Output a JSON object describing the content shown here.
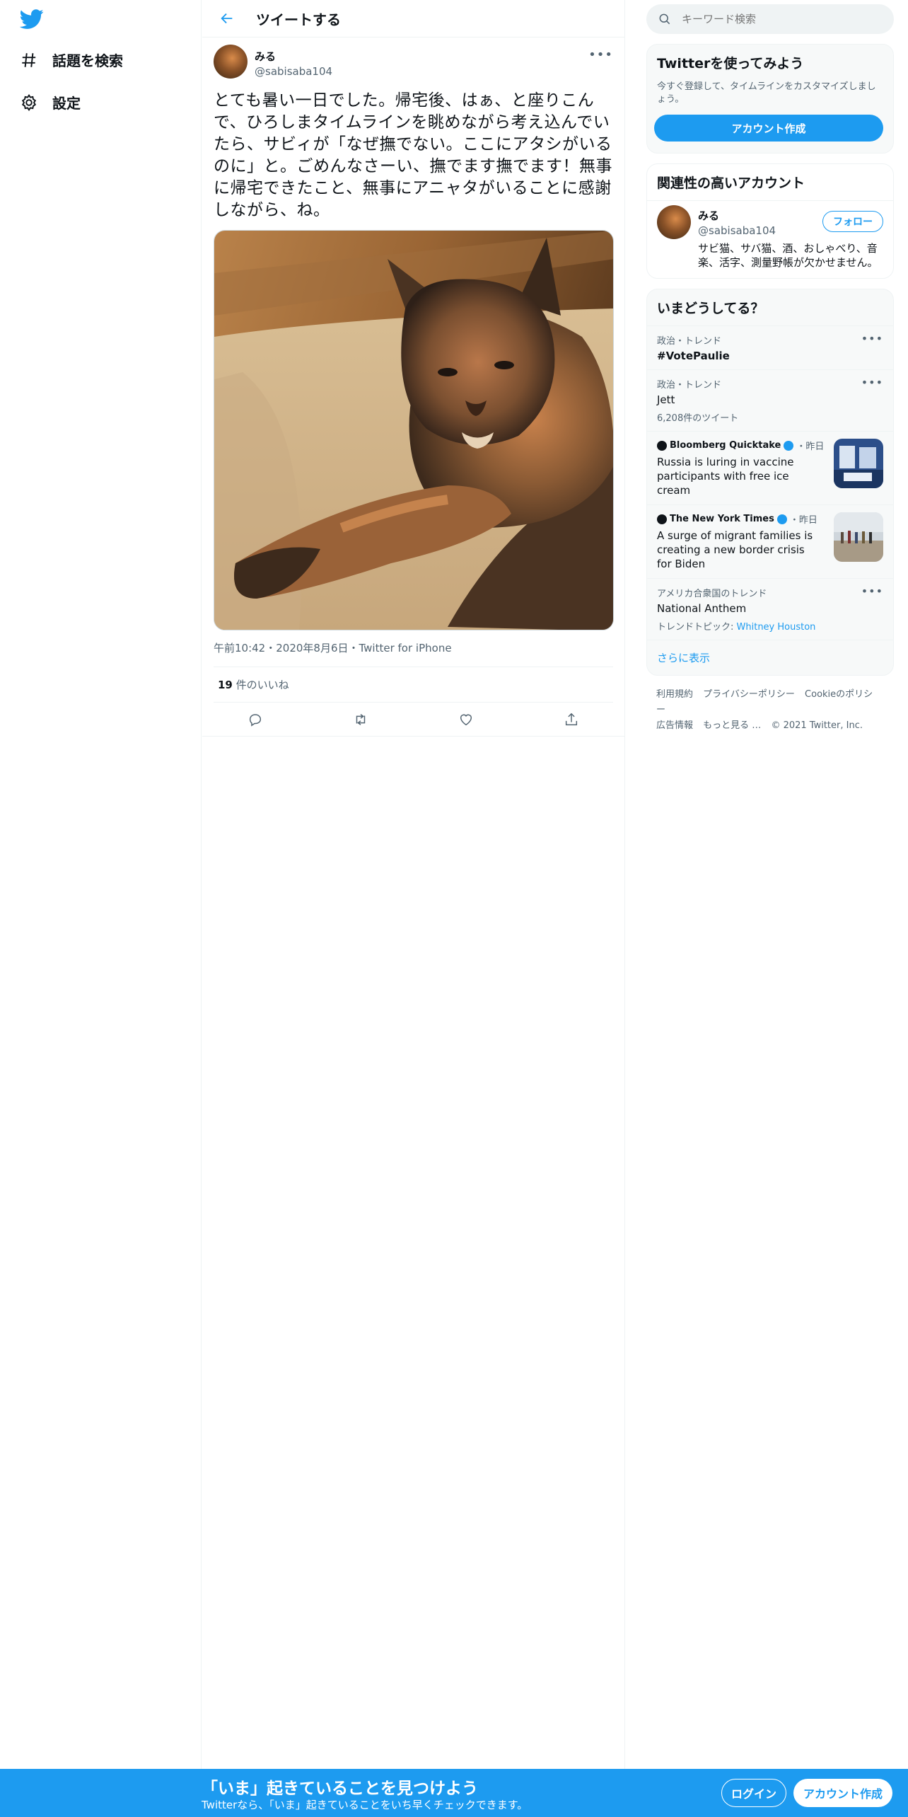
{
  "nav": {
    "explore_label": "話題を検索",
    "settings_label": "設定"
  },
  "header": {
    "title": "ツイートする"
  },
  "tweet": {
    "author_name": "みる",
    "author_handle": "@sabisaba104",
    "text": "とても暑い一日でした。帰宅後、はぁ、と座りこんで、ひろしまタイムラインを眺めながら考え込んでいたら、サビィが「なぜ撫でない。ここにアタシがいるのに」と。ごめんなさーい、撫でます撫でます！無事に帰宅できたこと、無事にアニャタがいることに感謝しながら、ね。",
    "meta": "午前10:42・2020年8月6日・Twitter for iPhone",
    "likes_count": "19",
    "likes_label": " 件のいいね"
  },
  "search": {
    "placeholder": "キーワード検索"
  },
  "signup_card": {
    "title": "Twitterを使ってみよう",
    "description": "今すぐ登録して、タイムラインをカスタマイズしましょう。",
    "button": "アカウント作成"
  },
  "related": {
    "title": "関連性の高いアカウント",
    "account": {
      "name": "みる",
      "handle": "@sabisaba104",
      "follow": "フォロー",
      "bio": "サビ猫、サバ猫、酒、おしゃべり、音楽、活字、測量野帳が欠かせません。"
    }
  },
  "trends": {
    "title": "いまどうしてる？",
    "items": [
      {
        "category": "政治・トレンド",
        "name": "#VotePaulie"
      },
      {
        "category": "政治・トレンド",
        "name": "Jett",
        "count": "6,208件のツイート"
      }
    ],
    "news": [
      {
        "source": "Bloomberg Quicktake",
        "time": "・昨日",
        "headline": "Russia is luring in vaccine participants with free ice cream"
      },
      {
        "source": "The New York Times",
        "time": "・昨日",
        "headline": "A surge of migrant families is creating a new border crisis for Biden"
      }
    ],
    "last": {
      "category": "アメリカ合衆国のトレンド",
      "name": "National Anthem",
      "topic_label": "トレンドトピック: ",
      "topic_link": "Whitney Houston"
    },
    "show_more": "さらに表示"
  },
  "footer": {
    "links": [
      "利用規約",
      "プライバシーポリシー",
      "Cookieのポリシー",
      "広告情報",
      "もっと見る …",
      "© 2021 Twitter, Inc."
    ]
  },
  "banner": {
    "title": "「いま」起きていることを見つけよう",
    "subtitle": "Twitterなら、「いま」起きていることをいち早くチェックできます。",
    "login": "ログイン",
    "signup": "アカウント作成"
  },
  "colors": {
    "accent": "#1d9bf0",
    "text": "#0f1419",
    "secondary": "#536471"
  },
  "icons": [
    "twitter-logo-icon",
    "hashtag-icon",
    "gear-icon",
    "back-arrow-icon",
    "more-icon",
    "reply-icon",
    "retweet-icon",
    "like-icon",
    "share-icon",
    "search-icon",
    "verified-icon"
  ]
}
